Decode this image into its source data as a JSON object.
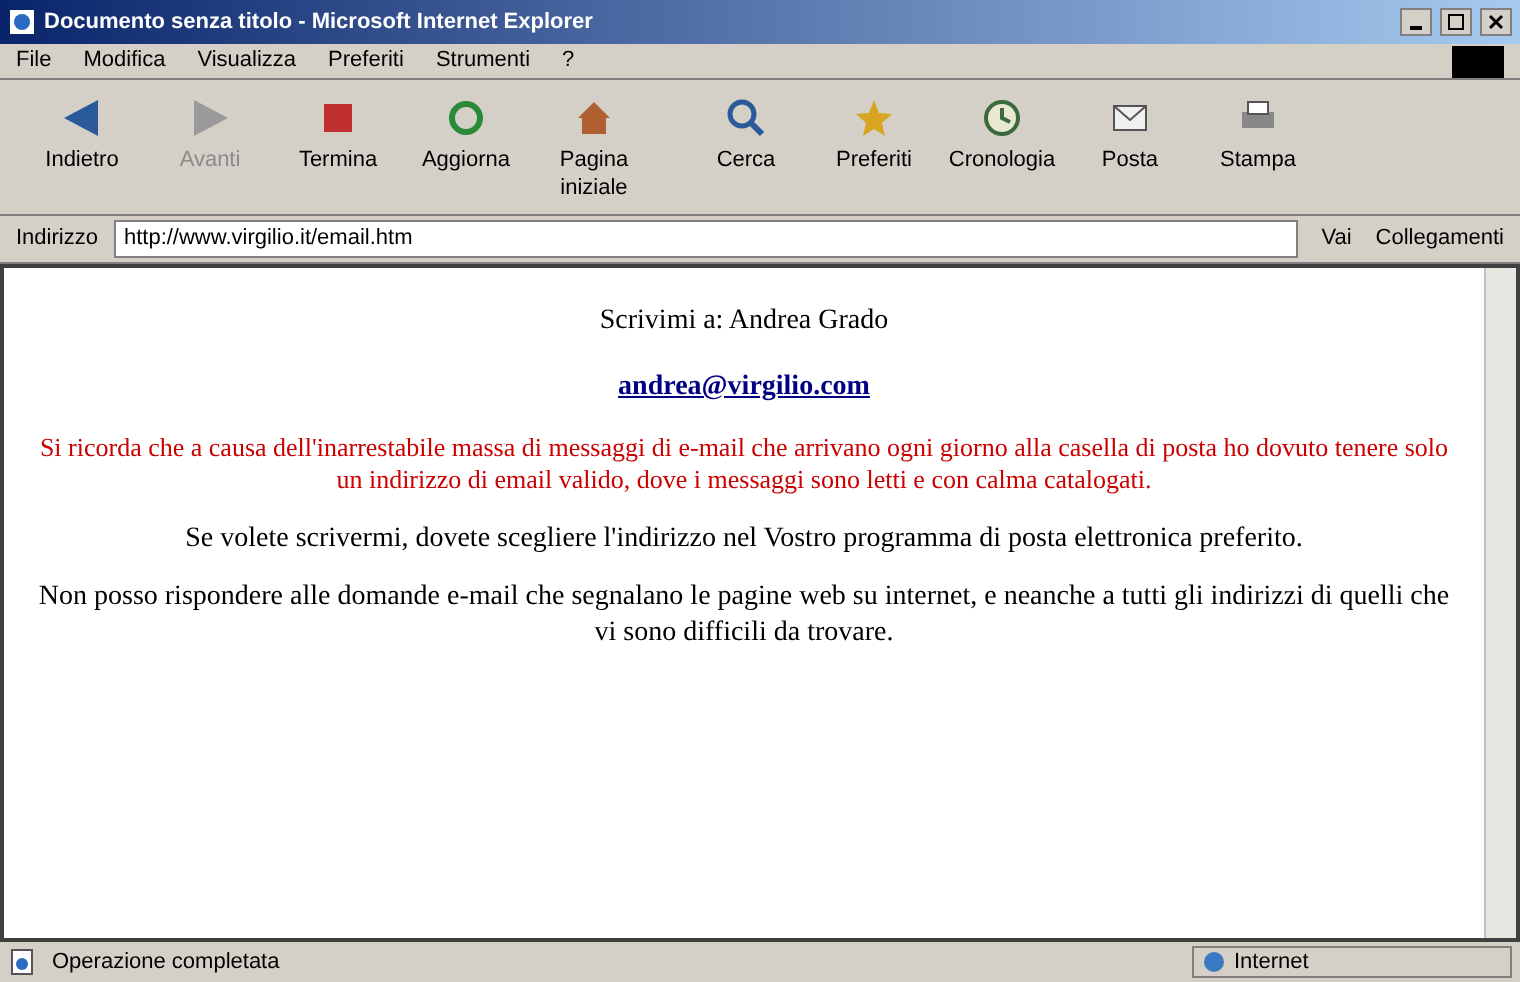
{
  "window": {
    "title": "Documento senza titolo - Microsoft Internet Explorer"
  },
  "menu": [
    "File",
    "Modifica",
    "Visualizza",
    "Preferiti",
    "Strumenti",
    "?"
  ],
  "toolbar": [
    {
      "label": "Indietro",
      "kind": "back",
      "disabled": false
    },
    {
      "label": "Avanti",
      "kind": "forward",
      "disabled": true
    },
    {
      "label": "Termina",
      "kind": "stop",
      "disabled": false
    },
    {
      "label": "Aggiorna",
      "kind": "refresh",
      "disabled": false
    },
    {
      "label": "Pagina iniziale",
      "kind": "home",
      "disabled": false
    },
    {
      "label": "Cerca",
      "kind": "search",
      "disabled": false
    },
    {
      "label": "Preferiti",
      "kind": "favorites",
      "disabled": false
    },
    {
      "label": "Cronologia",
      "kind": "history",
      "disabled": false
    },
    {
      "label": "Posta",
      "kind": "mail",
      "disabled": false
    },
    {
      "label": "Stampa",
      "kind": "print",
      "disabled": false
    }
  ],
  "address_bar": {
    "label": "Indirizzo",
    "value": "http://www.virgilio.it/email.htm",
    "go": "Vai",
    "links": "Collegamenti"
  },
  "page": {
    "heading": "Scrivimi a: Andrea Grado",
    "email": "andrea@virgilio.com",
    "notice": "Si ricorda che a causa dell'inarrestabile massa di messaggi di e-mail che arrivano ogni giorno alla casella di posta ho dovuto tenere solo un indirizzo di email valido, dove i messaggi sono letti e con calma catalogati.",
    "paragraphs": [
      "Se volete scrivermi, dovete scegliere l'indirizzo nel Vostro programma di posta elettronica preferito.",
      "Non posso rispondere alle domande e-mail che segnalano le pagine web su internet, e neanche a tutti gli indirizzi di quelli che vi sono difficili da trovare."
    ]
  },
  "status_bar": {
    "text": "Operazione completata",
    "zone": "Internet"
  }
}
